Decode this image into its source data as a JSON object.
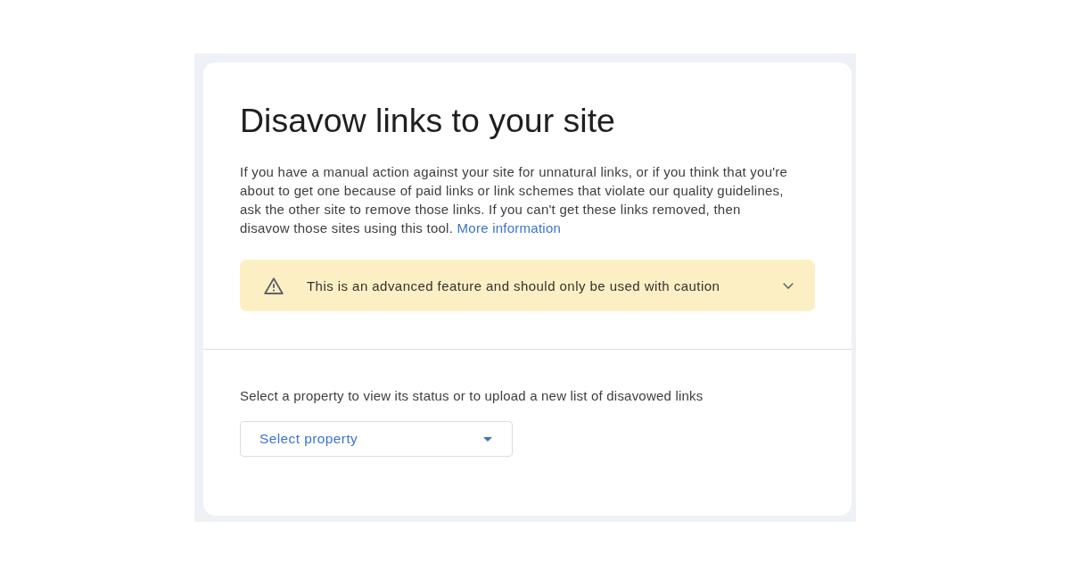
{
  "page": {
    "title": "Disavow links to your site",
    "description": {
      "text": "If you have a manual action against your site for unnatural links, or if you think that you're about to get one because of paid links or link schemes that violate our quality guidelines, ask the other site to remove those links. If you can't get these links removed, then disavow those sites using this tool.",
      "link": "More information"
    },
    "warning": {
      "text": "This is an advanced feature and should only be used with caution",
      "expanded": false
    },
    "property_section": {
      "label": "Select a property to view its status or to upload a new list of disavowed links",
      "select": {
        "placeholder": "Select property"
      }
    }
  }
}
